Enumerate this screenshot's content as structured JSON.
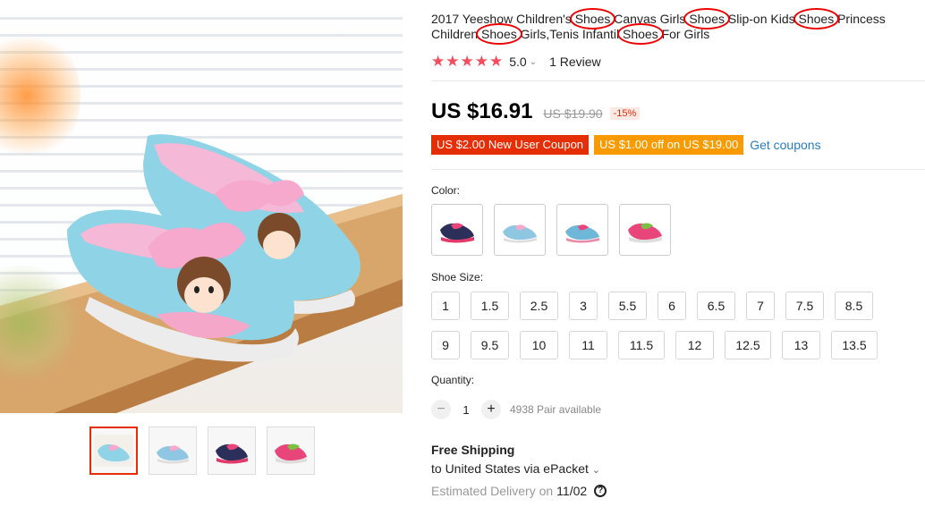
{
  "product": {
    "title_parts": [
      {
        "text": "2017 Yeeshow Children's ",
        "mark": false
      },
      {
        "text": "Shoes",
        "mark": true
      },
      {
        "text": " Canvas Girls ",
        "mark": false
      },
      {
        "text": "Shoes",
        "mark": true
      },
      {
        "text": " Slip-on Kids ",
        "mark": false
      },
      {
        "text": "Shoes",
        "mark": true
      },
      {
        "text": " Princess Children ",
        "mark": false
      },
      {
        "text": "Shoes",
        "mark": true
      },
      {
        "text": " Girls,Tenis Infantil ",
        "mark": false
      },
      {
        "text": "Shoes",
        "mark": true
      },
      {
        "text": " For Girls",
        "mark": false
      }
    ]
  },
  "rating": {
    "stars": "★★★★★",
    "score": "5.0",
    "reviews": "1 Review"
  },
  "price": {
    "current": "US $16.91",
    "original": "US $19.90",
    "discount": "-15%"
  },
  "coupons": {
    "new_user": "US $2.00 New User Coupon",
    "store": "US $1.00 off on US $19.00",
    "get_label": "Get coupons"
  },
  "color": {
    "label": "Color:",
    "options": [
      "navy-pink",
      "light-blue",
      "blue-pink",
      "pink-green"
    ]
  },
  "size": {
    "label": "Shoe Size:",
    "row1": [
      "1",
      "1.5",
      "2.5",
      "3",
      "5.5",
      "6",
      "6.5",
      "7",
      "7.5",
      "8.5"
    ],
    "row2": [
      "9",
      "9.5",
      "10",
      "11",
      "11.5",
      "12",
      "12.5",
      "13",
      "13.5"
    ]
  },
  "quantity": {
    "label": "Quantity:",
    "value": "1",
    "minus": "−",
    "plus": "+",
    "available": "4938 Pair available"
  },
  "shipping": {
    "title": "Free Shipping",
    "to": "to United States via ePacket",
    "delivery_label": "Estimated Delivery on",
    "delivery_date": "11/02",
    "help_icon": "?"
  },
  "colors": {
    "accent_red": "#e62e04",
    "coupon_orange": "#f99b00",
    "link_blue": "#2a7dbd",
    "star": "#f44c5c",
    "annotation_red": "#e00000"
  }
}
